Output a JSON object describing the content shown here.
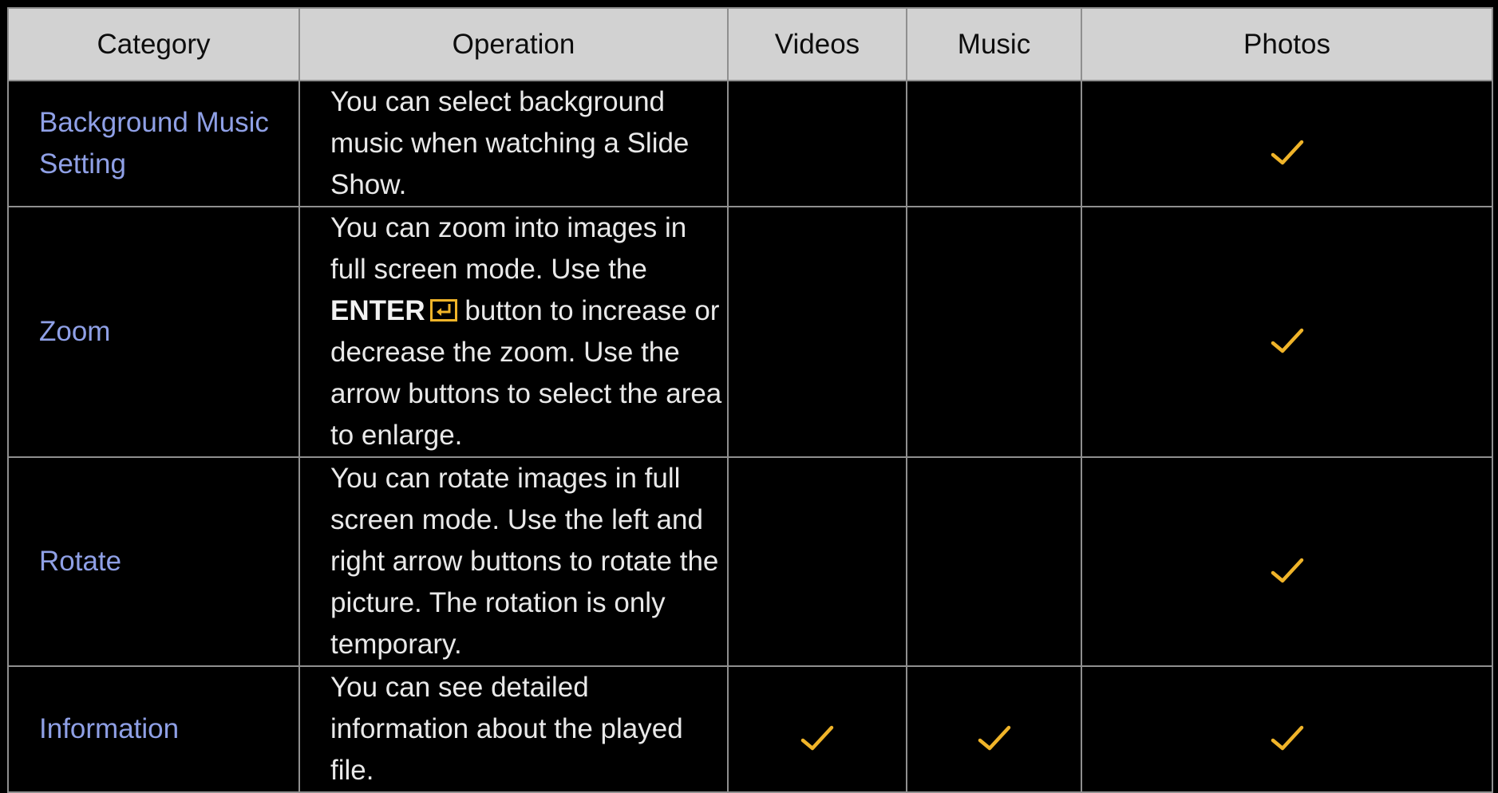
{
  "table": {
    "headers": [
      "Category",
      "Operation",
      "Videos",
      "Music",
      "Photos"
    ],
    "rows": [
      {
        "category": "Background Music Setting",
        "operation": "You can select background music when watching a Slide Show.",
        "videos": false,
        "music": false,
        "photos": true
      },
      {
        "category": "Zoom",
        "operation_before": "You can zoom into images in full screen mode. Use the",
        "operation_bold": "ENTER",
        "operation_after": "button to increase or decrease the zoom. Use the arrow buttons to select the area to enlarge.",
        "videos": false,
        "music": false,
        "photos": true
      },
      {
        "category": "Rotate",
        "operation": "You can rotate images in full screen mode. Use the left and right arrow buttons to rotate the picture. The rotation is only temporary.",
        "videos": false,
        "music": false,
        "photos": true
      },
      {
        "category": "Information",
        "operation": "You can see detailed information about the played file.",
        "videos": true,
        "music": true,
        "photos": true
      }
    ]
  },
  "icons": {
    "check": "checkmark-icon",
    "enter": "enter-key-icon"
  },
  "colors": {
    "header_bg": "#d2d2d2",
    "category_text": "#8fa0e6",
    "check": "#f0b429",
    "enter_icon": "#f0b429"
  }
}
